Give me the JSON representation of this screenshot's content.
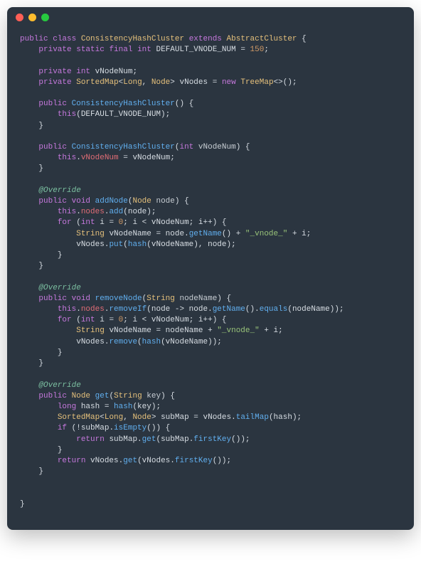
{
  "window": {
    "dots": [
      "red",
      "yellow",
      "green"
    ]
  },
  "code": {
    "l1": {
      "kw1": "public",
      "kw2": "class",
      "cls": "ConsistencyHashCluster",
      "kw3": "extends",
      "sup": "AbstractCluster",
      "brace": "{"
    },
    "l2": {
      "kw1": "private",
      "kw2": "static",
      "kw3": "final",
      "kw4": "int",
      "name": "DEFAULT_VNODE_NUM",
      "eq": "=",
      "val": "150",
      "semi": ";"
    },
    "l4": {
      "kw1": "private",
      "kw2": "int",
      "name": "vNodeNum",
      "semi": ";"
    },
    "l5": {
      "kw1": "private",
      "type": "SortedMap",
      "lt": "<",
      "t1": "Long",
      "comma": ", ",
      "t2": "Node",
      "gt": ">",
      "name": "vNodes",
      "eq": "=",
      "kw2": "new",
      "type2": "TreeMap",
      "diamond": "<>()",
      "semi": ";"
    },
    "l7": {
      "kw1": "public",
      "ctor": "ConsistencyHashCluster",
      "args": "()",
      "brace": "{"
    },
    "l8": {
      "this": "this",
      "call": "(DEFAULT_VNODE_NUM)",
      "semi": ";"
    },
    "l9": {
      "brace": "}"
    },
    "l11": {
      "kw1": "public",
      "ctor": "ConsistencyHashCluster",
      "open": "(",
      "kw2": "int",
      "param": "vNodeNum",
      "close": ")",
      "brace": "{"
    },
    "l12": {
      "this": "this",
      "dot": ".",
      "fld": "vNodeNum",
      "eq": " = ",
      "rhs": "vNodeNum",
      "semi": ";"
    },
    "l13": {
      "brace": "}"
    },
    "l15": {
      "annot": "@Override"
    },
    "l16": {
      "kw1": "public",
      "kw2": "void",
      "m": "addNode",
      "open": "(",
      "ptype": "Node",
      "pname": "node",
      "close": ")",
      "brace": "{"
    },
    "l17": {
      "this": "this",
      "dot1": ".",
      "fld": "nodes",
      "dot2": ".",
      "m": "add",
      "args": "(node)",
      "semi": ";"
    },
    "l18": {
      "kw": "for",
      "open": " (",
      "kw2": "int",
      "var": "i",
      "eq": " = ",
      "zero": "0",
      "semi1": "; ",
      "cond": "i < vNodeNum",
      "semi2": "; ",
      "inc": "i++",
      "close": ")",
      "brace": " {"
    },
    "l19": {
      "type": "String",
      "var": "vNodeName",
      "eq": " = ",
      "rhs1": "node.",
      "m": "getName",
      "call": "()",
      "plus1": " + ",
      "str": "\"_vnode_\"",
      "plus2": " + ",
      "i": "i",
      "semi": ";"
    },
    "l20": {
      "obj": "vNodes",
      "dot": ".",
      "m": "put",
      "open": "(",
      "m2": "hash",
      "args2": "(vNodeName)",
      "comma": ", ",
      "arg3": "node",
      "close": ")",
      "semi": ";"
    },
    "l21": {
      "brace": "}"
    },
    "l22": {
      "brace": "}"
    },
    "l24": {
      "annot": "@Override"
    },
    "l25": {
      "kw1": "public",
      "kw2": "void",
      "m": "removeNode",
      "open": "(",
      "ptype": "String",
      "pname": "nodeName",
      "close": ")",
      "brace": "{"
    },
    "l26": {
      "this": "this",
      "dot1": ".",
      "fld": "nodes",
      "dot2": ".",
      "m": "removeIf",
      "open": "(",
      "lam": "node -> node.",
      "m2": "getName",
      "call": "().",
      "m3": "equals",
      "args3": "(nodeName)",
      "close": ")",
      "semi": ";"
    },
    "l27": {
      "kw": "for",
      "open": " (",
      "kw2": "int",
      "var": "i",
      "eq": " = ",
      "zero": "0",
      "semi1": "; ",
      "cond": "i < vNodeNum",
      "semi2": "; ",
      "inc": "i++",
      "close": ")",
      "brace": " {"
    },
    "l28": {
      "type": "String",
      "var": "vNodeName",
      "eq": " = ",
      "rhs": "nodeName",
      "plus1": " + ",
      "str": "\"_vnode_\"",
      "plus2": " + ",
      "i": "i",
      "semi": ";"
    },
    "l29": {
      "obj": "vNodes",
      "dot": ".",
      "m": "remove",
      "open": "(",
      "m2": "hash",
      "args2": "(vNodeName)",
      "close": ")",
      "semi": ";"
    },
    "l30": {
      "brace": "}"
    },
    "l31": {
      "brace": "}"
    },
    "l33": {
      "annot": "@Override"
    },
    "l34": {
      "kw1": "public",
      "type": "Node",
      "m": "get",
      "open": "(",
      "ptype": "String",
      "pname": "key",
      "close": ")",
      "brace": "{"
    },
    "l35": {
      "kw": "long",
      "var": "hash",
      "eq": " = ",
      "m": "hash",
      "args": "(key)",
      "semi": ";"
    },
    "l36": {
      "type": "SortedMap",
      "lt": "<",
      "t1": "Long",
      "comma": ", ",
      "t2": "Node",
      "gt": ">",
      "var": "subMap",
      "eq": " = ",
      "obj": "vNodes",
      "dot": ".",
      "m": "tailMap",
      "args": "(hash)",
      "semi": ";"
    },
    "l37": {
      "kw": "if",
      "open": " (!",
      "obj": "subMap",
      "dot": ".",
      "m": "isEmpty",
      "call": "()",
      "close": ")",
      "brace": " {"
    },
    "l38": {
      "kw": "return",
      "sp": " ",
      "obj": "subMap",
      "dot": ".",
      "m": "get",
      "open": "(",
      "obj2": "subMap",
      "dot2": ".",
      "m2": "firstKey",
      "call": "()",
      "close": ")",
      "semi": ";"
    },
    "l39": {
      "brace": "}"
    },
    "l40": {
      "kw": "return",
      "sp": " ",
      "obj": "vNodes",
      "dot": ".",
      "m": "get",
      "open": "(",
      "obj2": "vNodes",
      "dot2": ".",
      "m2": "firstKey",
      "call": "()",
      "close": ")",
      "semi": ";"
    },
    "l41": {
      "brace": "}"
    },
    "l44": {
      "brace": "}"
    }
  }
}
